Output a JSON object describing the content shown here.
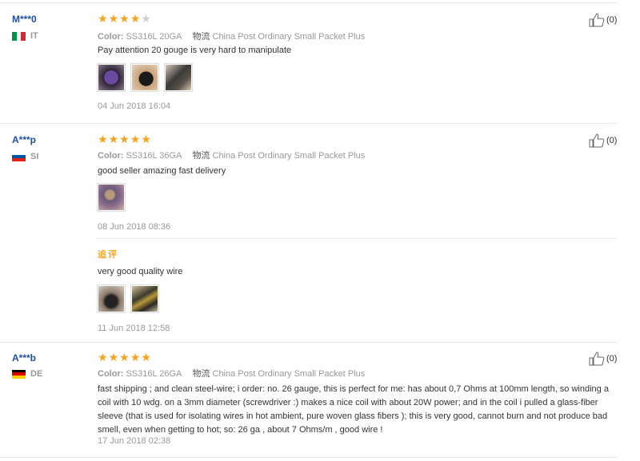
{
  "labels": {
    "color": "Color:",
    "logistics": "物流",
    "additional_review": "追评"
  },
  "reviews": [
    {
      "user": "M***0",
      "country": "IT",
      "rating": 4,
      "color_value": "SS316L 20GA",
      "logistics_value": "China Post Ordinary Small Packet Plus",
      "text": "Pay attention 20 gouge is very hard to manipulate",
      "date": "04 Jun 2018 16:04",
      "likes": "(0)"
    },
    {
      "user": "A***p",
      "country": "SI",
      "rating": 5,
      "color_value": "SS316L 36GA",
      "logistics_value": "China Post Ordinary Small Packet Plus",
      "text": "good seller amazing fast delivery",
      "date": "08 Jun 2018 08:36",
      "likes": "(0)",
      "followup": {
        "text": "very good quality wire",
        "date": "11 Jun 2018 12:58"
      }
    },
    {
      "user": "A***b",
      "country": "DE",
      "rating": 5,
      "color_value": "SS316L 26GA",
      "logistics_value": "China Post Ordinary Small Packet Plus",
      "text": "fast shipping ; and clean steel-wire; i order: no. 26 gauge, this is perfect for me: has about 0,7 Ohms at 100mm length, so winding a coil with 10 wdg. on a 3mm diameter (screwdriver :) makes a nice coil with about 20W power; and in the coil i pulled a glass-fiber sleeve (that is used for isolating wires in hot ambient, pure woven glass fibers ); this is very good, cannot burn and not produce bad smell, even when getting to hot; so: 26 ga , about 7 Ohms/m , good wire !",
      "date": "17 Jun 2018 02:38",
      "likes": "(0)"
    }
  ]
}
